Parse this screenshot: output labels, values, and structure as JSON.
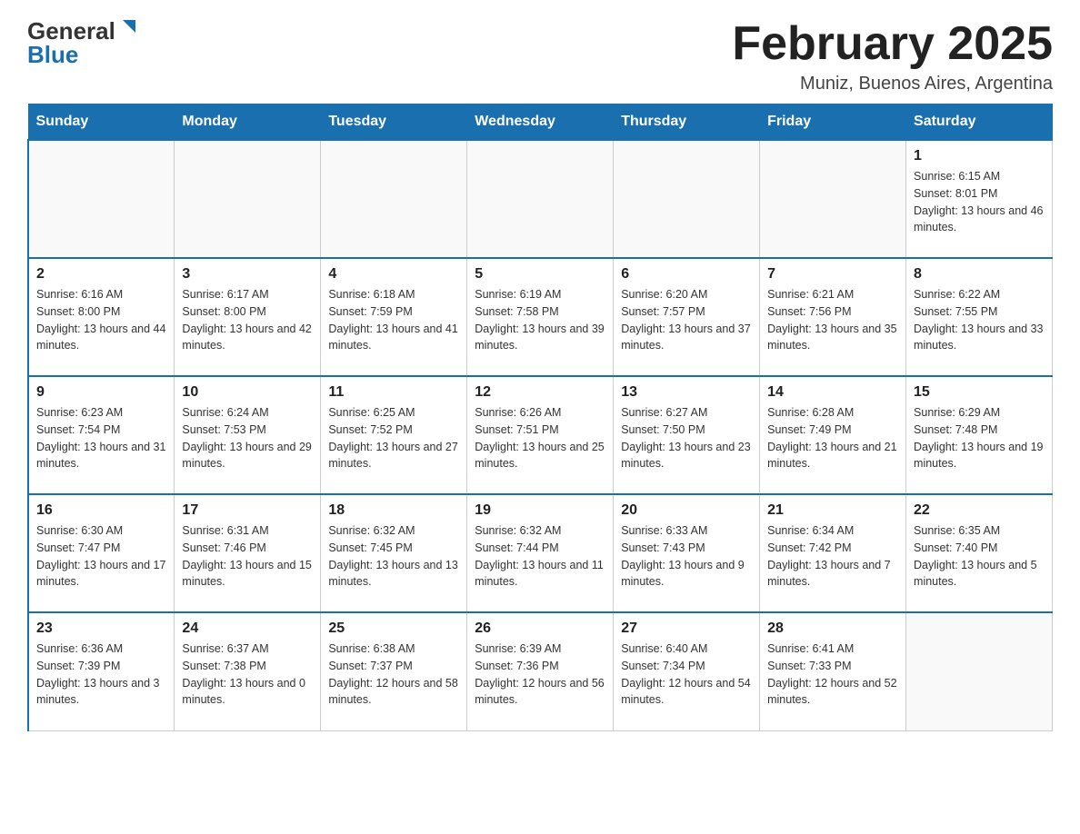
{
  "logo": {
    "general": "General",
    "blue": "Blue",
    "arrow": "▶"
  },
  "title": "February 2025",
  "subtitle": "Muniz, Buenos Aires, Argentina",
  "weekdays": [
    "Sunday",
    "Monday",
    "Tuesday",
    "Wednesday",
    "Thursday",
    "Friday",
    "Saturday"
  ],
  "weeks": [
    [
      {
        "day": "",
        "info": ""
      },
      {
        "day": "",
        "info": ""
      },
      {
        "day": "",
        "info": ""
      },
      {
        "day": "",
        "info": ""
      },
      {
        "day": "",
        "info": ""
      },
      {
        "day": "",
        "info": ""
      },
      {
        "day": "1",
        "info": "Sunrise: 6:15 AM\nSunset: 8:01 PM\nDaylight: 13 hours and 46 minutes."
      }
    ],
    [
      {
        "day": "2",
        "info": "Sunrise: 6:16 AM\nSunset: 8:00 PM\nDaylight: 13 hours and 44 minutes."
      },
      {
        "day": "3",
        "info": "Sunrise: 6:17 AM\nSunset: 8:00 PM\nDaylight: 13 hours and 42 minutes."
      },
      {
        "day": "4",
        "info": "Sunrise: 6:18 AM\nSunset: 7:59 PM\nDaylight: 13 hours and 41 minutes."
      },
      {
        "day": "5",
        "info": "Sunrise: 6:19 AM\nSunset: 7:58 PM\nDaylight: 13 hours and 39 minutes."
      },
      {
        "day": "6",
        "info": "Sunrise: 6:20 AM\nSunset: 7:57 PM\nDaylight: 13 hours and 37 minutes."
      },
      {
        "day": "7",
        "info": "Sunrise: 6:21 AM\nSunset: 7:56 PM\nDaylight: 13 hours and 35 minutes."
      },
      {
        "day": "8",
        "info": "Sunrise: 6:22 AM\nSunset: 7:55 PM\nDaylight: 13 hours and 33 minutes."
      }
    ],
    [
      {
        "day": "9",
        "info": "Sunrise: 6:23 AM\nSunset: 7:54 PM\nDaylight: 13 hours and 31 minutes."
      },
      {
        "day": "10",
        "info": "Sunrise: 6:24 AM\nSunset: 7:53 PM\nDaylight: 13 hours and 29 minutes."
      },
      {
        "day": "11",
        "info": "Sunrise: 6:25 AM\nSunset: 7:52 PM\nDaylight: 13 hours and 27 minutes."
      },
      {
        "day": "12",
        "info": "Sunrise: 6:26 AM\nSunset: 7:51 PM\nDaylight: 13 hours and 25 minutes."
      },
      {
        "day": "13",
        "info": "Sunrise: 6:27 AM\nSunset: 7:50 PM\nDaylight: 13 hours and 23 minutes."
      },
      {
        "day": "14",
        "info": "Sunrise: 6:28 AM\nSunset: 7:49 PM\nDaylight: 13 hours and 21 minutes."
      },
      {
        "day": "15",
        "info": "Sunrise: 6:29 AM\nSunset: 7:48 PM\nDaylight: 13 hours and 19 minutes."
      }
    ],
    [
      {
        "day": "16",
        "info": "Sunrise: 6:30 AM\nSunset: 7:47 PM\nDaylight: 13 hours and 17 minutes."
      },
      {
        "day": "17",
        "info": "Sunrise: 6:31 AM\nSunset: 7:46 PM\nDaylight: 13 hours and 15 minutes."
      },
      {
        "day": "18",
        "info": "Sunrise: 6:32 AM\nSunset: 7:45 PM\nDaylight: 13 hours and 13 minutes."
      },
      {
        "day": "19",
        "info": "Sunrise: 6:32 AM\nSunset: 7:44 PM\nDaylight: 13 hours and 11 minutes."
      },
      {
        "day": "20",
        "info": "Sunrise: 6:33 AM\nSunset: 7:43 PM\nDaylight: 13 hours and 9 minutes."
      },
      {
        "day": "21",
        "info": "Sunrise: 6:34 AM\nSunset: 7:42 PM\nDaylight: 13 hours and 7 minutes."
      },
      {
        "day": "22",
        "info": "Sunrise: 6:35 AM\nSunset: 7:40 PM\nDaylight: 13 hours and 5 minutes."
      }
    ],
    [
      {
        "day": "23",
        "info": "Sunrise: 6:36 AM\nSunset: 7:39 PM\nDaylight: 13 hours and 3 minutes."
      },
      {
        "day": "24",
        "info": "Sunrise: 6:37 AM\nSunset: 7:38 PM\nDaylight: 13 hours and 0 minutes."
      },
      {
        "day": "25",
        "info": "Sunrise: 6:38 AM\nSunset: 7:37 PM\nDaylight: 12 hours and 58 minutes."
      },
      {
        "day": "26",
        "info": "Sunrise: 6:39 AM\nSunset: 7:36 PM\nDaylight: 12 hours and 56 minutes."
      },
      {
        "day": "27",
        "info": "Sunrise: 6:40 AM\nSunset: 7:34 PM\nDaylight: 12 hours and 54 minutes."
      },
      {
        "day": "28",
        "info": "Sunrise: 6:41 AM\nSunset: 7:33 PM\nDaylight: 12 hours and 52 minutes."
      },
      {
        "day": "",
        "info": ""
      }
    ]
  ]
}
